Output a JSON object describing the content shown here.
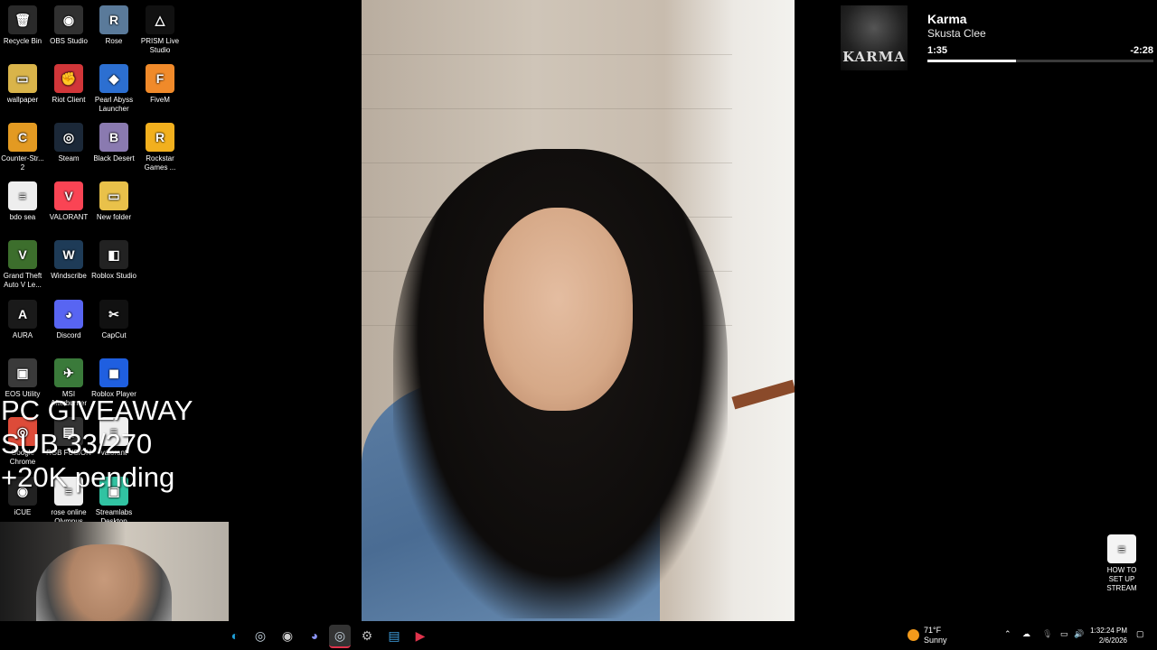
{
  "desktop": {
    "icons": [
      {
        "label": "Recycle Bin",
        "color": "#2a2a2a",
        "glyph": "🗑"
      },
      {
        "label": "OBS Studio",
        "color": "#303030",
        "glyph": "◉"
      },
      {
        "label": "Rose",
        "color": "#5a7a9a",
        "glyph": "R"
      },
      {
        "label": "PRISM Live Studio",
        "color": "#111111",
        "glyph": "△"
      },
      {
        "label": "wallpaper",
        "color": "#d9b44a",
        "glyph": "▭"
      },
      {
        "label": "Riot Client",
        "color": "#d13639",
        "glyph": "✊"
      },
      {
        "label": "Pearl Abyss Launcher",
        "color": "#2c6fd1",
        "glyph": "◆"
      },
      {
        "label": "FiveM",
        "color": "#f08a2a",
        "glyph": "F"
      },
      {
        "label": "Counter-Str... 2",
        "color": "#e39a22",
        "glyph": "C"
      },
      {
        "label": "Steam",
        "color": "#1b2838",
        "glyph": "◎"
      },
      {
        "label": "Black Desert",
        "color": "#8a7ab0",
        "glyph": "B"
      },
      {
        "label": "Rockstar Games ...",
        "color": "#f2b01e",
        "glyph": "R"
      },
      {
        "label": "bdo sea",
        "color": "#eeeeee",
        "glyph": "≡"
      },
      {
        "label": "VALORANT",
        "color": "#fa4454",
        "glyph": "V"
      },
      {
        "label": "New folder",
        "color": "#e9c14a",
        "glyph": "▭"
      },
      {
        "label": "Grand Theft Auto V Le...",
        "color": "#3c6e2c",
        "glyph": "V"
      },
      {
        "label": "Windscribe",
        "color": "#1e3b57",
        "glyph": "W"
      },
      {
        "label": "Roblox Studio",
        "color": "#222222",
        "glyph": "◧"
      },
      {
        "label": "AURA",
        "color": "#1a1a1a",
        "glyph": "A"
      },
      {
        "label": "Discord",
        "color": "#5865f2",
        "glyph": "◕"
      },
      {
        "label": "CapCut",
        "color": "#111111",
        "glyph": "✂"
      },
      {
        "label": "EOS Utility",
        "color": "#3a3a3a",
        "glyph": "▣"
      },
      {
        "label": "MSI Afterburner",
        "color": "#3a7a3a",
        "glyph": "✈"
      },
      {
        "label": "Roblox Player",
        "color": "#1f5fe0",
        "glyph": "◼"
      },
      {
        "label": "Google Chrome",
        "color": "#dd4b39",
        "glyph": "◎"
      },
      {
        "label": "RGB FUSION",
        "color": "#333333",
        "glyph": "▤"
      },
      {
        "label": "valorant",
        "color": "#eeeeee",
        "glyph": "≡"
      },
      {
        "label": "iCUE",
        "color": "#222222",
        "glyph": "◉"
      },
      {
        "label": "rose online Olympus",
        "color": "#eeeeee",
        "glyph": "≡"
      },
      {
        "label": "Streamlabs Desktop",
        "color": "#31c3a2",
        "glyph": "▣"
      },
      {
        "label": "HOW TO SET UP STREAM",
        "color": "#f4f4f4",
        "glyph": "≡"
      }
    ]
  },
  "now_playing": {
    "album_art_text": "KARMA",
    "title": "Karma",
    "artist": "Skusta Clee",
    "elapsed": "1:35",
    "remaining": "-2:28",
    "progress": 0.39
  },
  "overlay": {
    "line1": "PC GIVEAWAY",
    "line2": "SUB 33/270",
    "line3": "+20K pending"
  },
  "taskbar": {
    "apps": [
      {
        "name": "edge-icon",
        "glyph": "◐",
        "color": "#1fa0d8"
      },
      {
        "name": "steam-icon",
        "glyph": "◎",
        "color": "#c7d5e0"
      },
      {
        "name": "obs-icon",
        "glyph": "◉",
        "color": "#cccccc"
      },
      {
        "name": "discord-icon",
        "glyph": "◕",
        "color": "#8a93f5"
      },
      {
        "name": "steam-active-icon",
        "glyph": "◎",
        "color": "#c7d5e0"
      },
      {
        "name": "settings-icon",
        "glyph": "⚙",
        "color": "#bbbbbb"
      },
      {
        "name": "notepad-icon",
        "glyph": "▤",
        "color": "#3fa0e0"
      },
      {
        "name": "media-player-icon",
        "glyph": "▶",
        "color": "#e0334c"
      }
    ],
    "weather_temp": "71°F",
    "weather_desc": "Sunny",
    "time": "1:32:24 PM",
    "date": "2/6/2026"
  }
}
